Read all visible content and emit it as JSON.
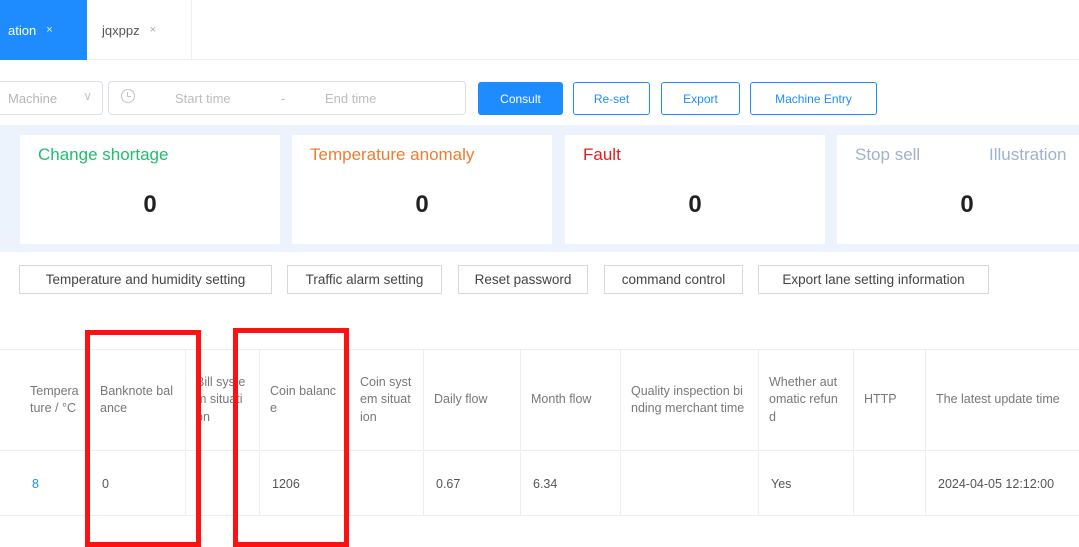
{
  "tabs": [
    {
      "label": "ation",
      "active": true
    },
    {
      "label": "jqxppz",
      "active": false
    }
  ],
  "tab_close_glyph": "×",
  "filters": {
    "machine_placeholder": "Machine",
    "start_placeholder": "Start time",
    "range_separator": "-",
    "end_placeholder": "End time"
  },
  "toolbar_buttons": {
    "consult": "Consult",
    "reset": "Re-set",
    "export": "Export",
    "machine_entry": "Machine Entry"
  },
  "stats": [
    {
      "label": "Change shortage",
      "value": "0",
      "color": "#1fbf6e"
    },
    {
      "label": "Temperature anomaly",
      "value": "0",
      "color": "#ee7d2f"
    },
    {
      "label": "Fault",
      "value": "0",
      "color": "#e02020"
    },
    {
      "label": "Stop sell",
      "extra_label": "Illustration",
      "value": "0",
      "color": "#9fb3cc"
    }
  ],
  "settings_buttons": [
    "Temperature and humidity setting",
    "Traffic alarm setting",
    "Reset password",
    "command control",
    "Export lane setting information"
  ],
  "table": {
    "columns": [
      "Temperature / °C",
      "Banknote balance",
      "Bill system situation",
      "Coin balance",
      "Coin system situation",
      "Daily flow",
      "Month flow",
      "Quality inspection binding merchant time",
      "Whether automatic refund",
      "HTTP",
      "The latest update time"
    ],
    "rows": [
      [
        "8",
        "0",
        "",
        "1206",
        "",
        "0.67",
        "6.34",
        "",
        "Yes",
        "",
        "2024-04-05 12:12:00"
      ]
    ]
  },
  "colors": {
    "accent": "#1e8cff",
    "annotation_red": "#ff1111"
  }
}
